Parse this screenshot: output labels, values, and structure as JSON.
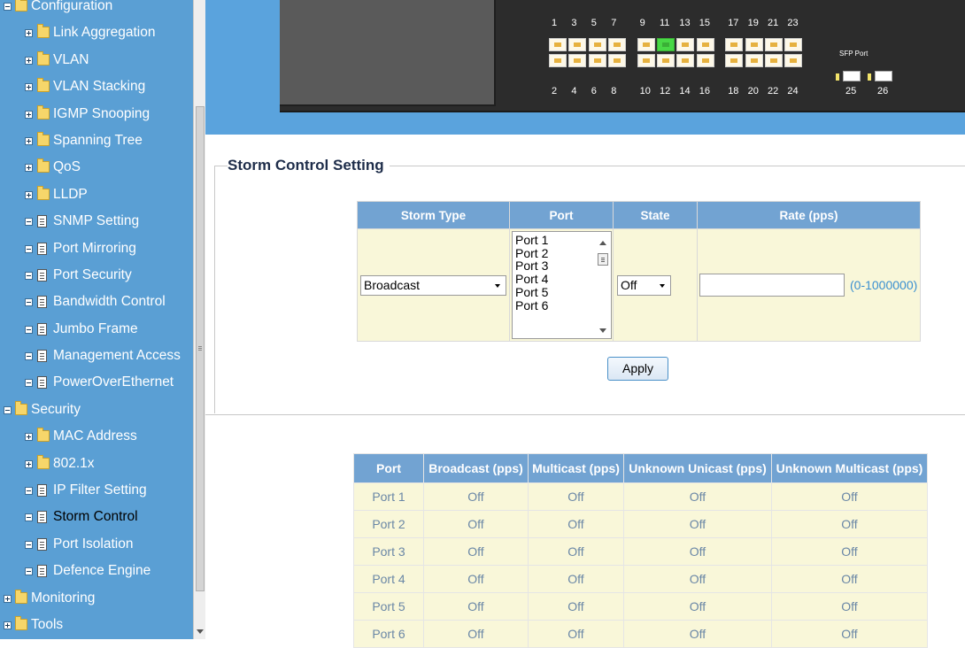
{
  "sidebar": {
    "items": [
      {
        "label": "Configuration",
        "level": 0,
        "expander": "minus",
        "icon": "folder-open-icon"
      },
      {
        "label": "Link Aggregation",
        "level": 1,
        "expander": "plus",
        "icon": "folder-icon"
      },
      {
        "label": "VLAN",
        "level": 1,
        "expander": "plus",
        "icon": "folder-icon"
      },
      {
        "label": "VLAN Stacking",
        "level": 1,
        "expander": "plus",
        "icon": "folder-icon"
      },
      {
        "label": "IGMP Snooping",
        "level": 1,
        "expander": "plus",
        "icon": "folder-icon"
      },
      {
        "label": "Spanning Tree",
        "level": 1,
        "expander": "plus",
        "icon": "folder-icon"
      },
      {
        "label": "QoS",
        "level": 1,
        "expander": "plus",
        "icon": "folder-icon"
      },
      {
        "label": "LLDP",
        "level": 1,
        "expander": "plus",
        "icon": "folder-icon"
      },
      {
        "label": "SNMP Setting",
        "level": 1,
        "expander": "minus",
        "icon": "page-icon"
      },
      {
        "label": "Port Mirroring",
        "level": 1,
        "expander": "minus",
        "icon": "page-icon"
      },
      {
        "label": "Port Security",
        "level": 1,
        "expander": "minus",
        "icon": "page-icon"
      },
      {
        "label": "Bandwidth Control",
        "level": 1,
        "expander": "minus",
        "icon": "page-icon"
      },
      {
        "label": "Jumbo Frame",
        "level": 1,
        "expander": "minus",
        "icon": "page-icon"
      },
      {
        "label": "Management Access",
        "level": 1,
        "expander": "minus",
        "icon": "page-icon"
      },
      {
        "label": "PowerOverEthernet",
        "level": 1,
        "expander": "minus",
        "icon": "page-icon"
      },
      {
        "label": "Security",
        "level": 0,
        "expander": "minus",
        "icon": "folder-open-icon"
      },
      {
        "label": "MAC Address",
        "level": 1,
        "expander": "plus",
        "icon": "folder-icon"
      },
      {
        "label": "802.1x",
        "level": 1,
        "expander": "plus",
        "icon": "folder-icon"
      },
      {
        "label": "IP Filter Setting",
        "level": 1,
        "expander": "minus",
        "icon": "page-icon"
      },
      {
        "label": "Storm Control",
        "level": 1,
        "expander": "minus",
        "icon": "page-icon",
        "selected": true
      },
      {
        "label": "Port Isolation",
        "level": 1,
        "expander": "minus",
        "icon": "page-icon"
      },
      {
        "label": "Defence Engine",
        "level": 1,
        "expander": "minus",
        "icon": "page-icon"
      },
      {
        "label": "Monitoring",
        "level": 0,
        "expander": "plus",
        "icon": "folder-icon"
      },
      {
        "label": "Tools",
        "level": 0,
        "expander": "plus",
        "icon": "folder-icon"
      }
    ]
  },
  "device": {
    "top_port_numbers": [
      "1",
      "3",
      "5",
      "7",
      "9",
      "11",
      "13",
      "15",
      "17",
      "19",
      "21",
      "23"
    ],
    "bottom_port_numbers": [
      "2",
      "4",
      "6",
      "8",
      "10",
      "12",
      "14",
      "16",
      "18",
      "20",
      "22",
      "24"
    ],
    "active_port": "11",
    "sfp_label": "SFP Port",
    "sfp_port_numbers": [
      "25",
      "26"
    ]
  },
  "storm_control": {
    "title": "Storm Control Setting",
    "headers": {
      "storm_type": "Storm Type",
      "port": "Port",
      "state": "State",
      "rate": "Rate (pps)"
    },
    "storm_type_value": "Broadcast",
    "port_options": [
      "Port 1",
      "Port 2",
      "Port 3",
      "Port 4",
      "Port 5",
      "Port 6"
    ],
    "state_value": "Off",
    "rate_value": "",
    "rate_range": "(0-1000000)",
    "apply_label": "Apply"
  },
  "status_table": {
    "headers": [
      "Port",
      "Broadcast (pps)",
      "Multicast (pps)",
      "Unknown Unicast (pps)",
      "Unknown Multicast (pps)"
    ],
    "rows": [
      [
        "Port 1",
        "Off",
        "Off",
        "Off",
        "Off"
      ],
      [
        "Port 2",
        "Off",
        "Off",
        "Off",
        "Off"
      ],
      [
        "Port 3",
        "Off",
        "Off",
        "Off",
        "Off"
      ],
      [
        "Port 4",
        "Off",
        "Off",
        "Off",
        "Off"
      ],
      [
        "Port 5",
        "Off",
        "Off",
        "Off",
        "Off"
      ],
      [
        "Port 6",
        "Off",
        "Off",
        "Off",
        "Off"
      ]
    ]
  }
}
